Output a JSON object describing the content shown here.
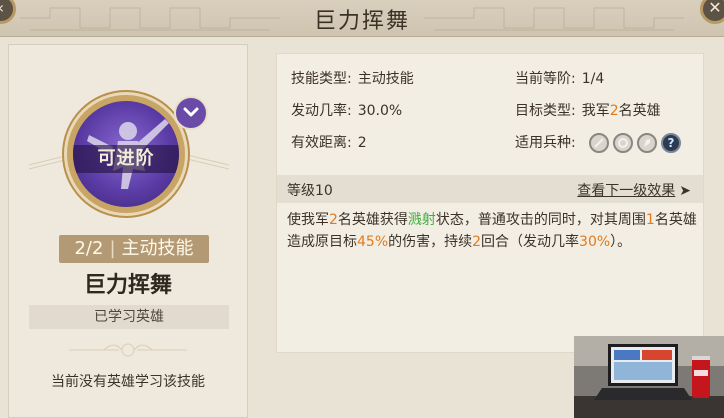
{
  "window": {
    "title": "巨力挥舞"
  },
  "left": {
    "advance_label": "可进阶",
    "level_count": "2/2",
    "level_sep": "|",
    "skill_type_short": "主动技能",
    "skill_name": "巨力挥舞",
    "learned_label": "已学习英雄",
    "no_hero_note": "当前没有英雄学习该技能"
  },
  "attrs": {
    "skill_type_label": "技能类型:",
    "skill_type_value": "主动技能",
    "current_tier_label": "当前等阶:",
    "current_tier_value": "1/4",
    "trigger_label": "发动几率:",
    "trigger_value": "30.0%",
    "target_label": "目标类型:",
    "target_prefix": "我军",
    "target_count": "2",
    "target_suffix": "名英雄",
    "range_label": "有效距离:",
    "range_value": "2",
    "troops_label": "适用兵种:",
    "troop_icons": [
      "sword-troop-icon",
      "shield-troop-icon",
      "horse-troop-icon",
      "unknown-troop-icon"
    ],
    "unknown_mark": "?"
  },
  "level_row": {
    "level": "等级10",
    "next_link": "查看下一级效果",
    "arrow": "➤"
  },
  "description": {
    "p1": "使我军",
    "n1": "2",
    "p2": "名英雄获得",
    "status": "溅射",
    "p3": "状态，普通攻击的同时，对其周围",
    "n2": "1",
    "p4": "名英雄造成原目标",
    "n3": "45%",
    "p5": "的伤害，持续",
    "n4": "2",
    "p6": "回合（发动几率",
    "n5": "30%",
    "p7": "）。"
  },
  "colors": {
    "highlight_orange": "#e07b1e",
    "highlight_green": "#3fae3f",
    "skill_purple": "#5c3ca6",
    "gold_frame": "#c9a565"
  }
}
